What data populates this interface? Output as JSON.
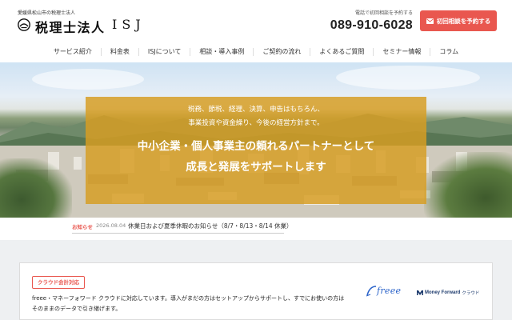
{
  "header": {
    "logo_sub": "愛媛県松山市の税理士法人",
    "logo_name": "税理士法人",
    "logo_isj": "ISJ",
    "phone_note": "電話で初回相談を予約する",
    "phone_number": "089-910-6028",
    "cta_label": "初回相談を予約する"
  },
  "nav": {
    "items": [
      {
        "label": "サービス紹介"
      },
      {
        "label": "料金表"
      },
      {
        "label": "ISJについて"
      },
      {
        "label": "相談・導入事例"
      },
      {
        "label": "ご契約の流れ"
      },
      {
        "label": "よくあるご質問"
      },
      {
        "label": "セミナー情報"
      },
      {
        "label": "コラム"
      }
    ]
  },
  "hero": {
    "line1": "税務、節税、経理、決算、申告はもちろん、",
    "line2": "事業投資や資金繰り、今後の経営方針まで。",
    "headline1": "中小企業・個人事業主の頼れるパートナーとして",
    "headline2": "成長と発展をサポートします"
  },
  "news": {
    "label": "お知らせ",
    "date": "2026.08.04",
    "text": "休業日および夏季休暇のお知らせ（8/7・8/13・8/14 休業）"
  },
  "cloud": {
    "badge": "クラウド会計対応",
    "text_line1": "freee・マネーフォワード クラウドに対応しています。導入がまだの方はセットアップからサポートし、すでにお使いの方は",
    "text_line2": "そのままのデータで引き継げます。",
    "freee_label": "freee",
    "mf_label": "Money Forward",
    "mf_ja": "クラウド"
  },
  "colors": {
    "accent": "#e9574f",
    "overlay": "#d69d23",
    "freee_blue": "#2b63c9",
    "mf_navy": "#1f3c6e"
  }
}
